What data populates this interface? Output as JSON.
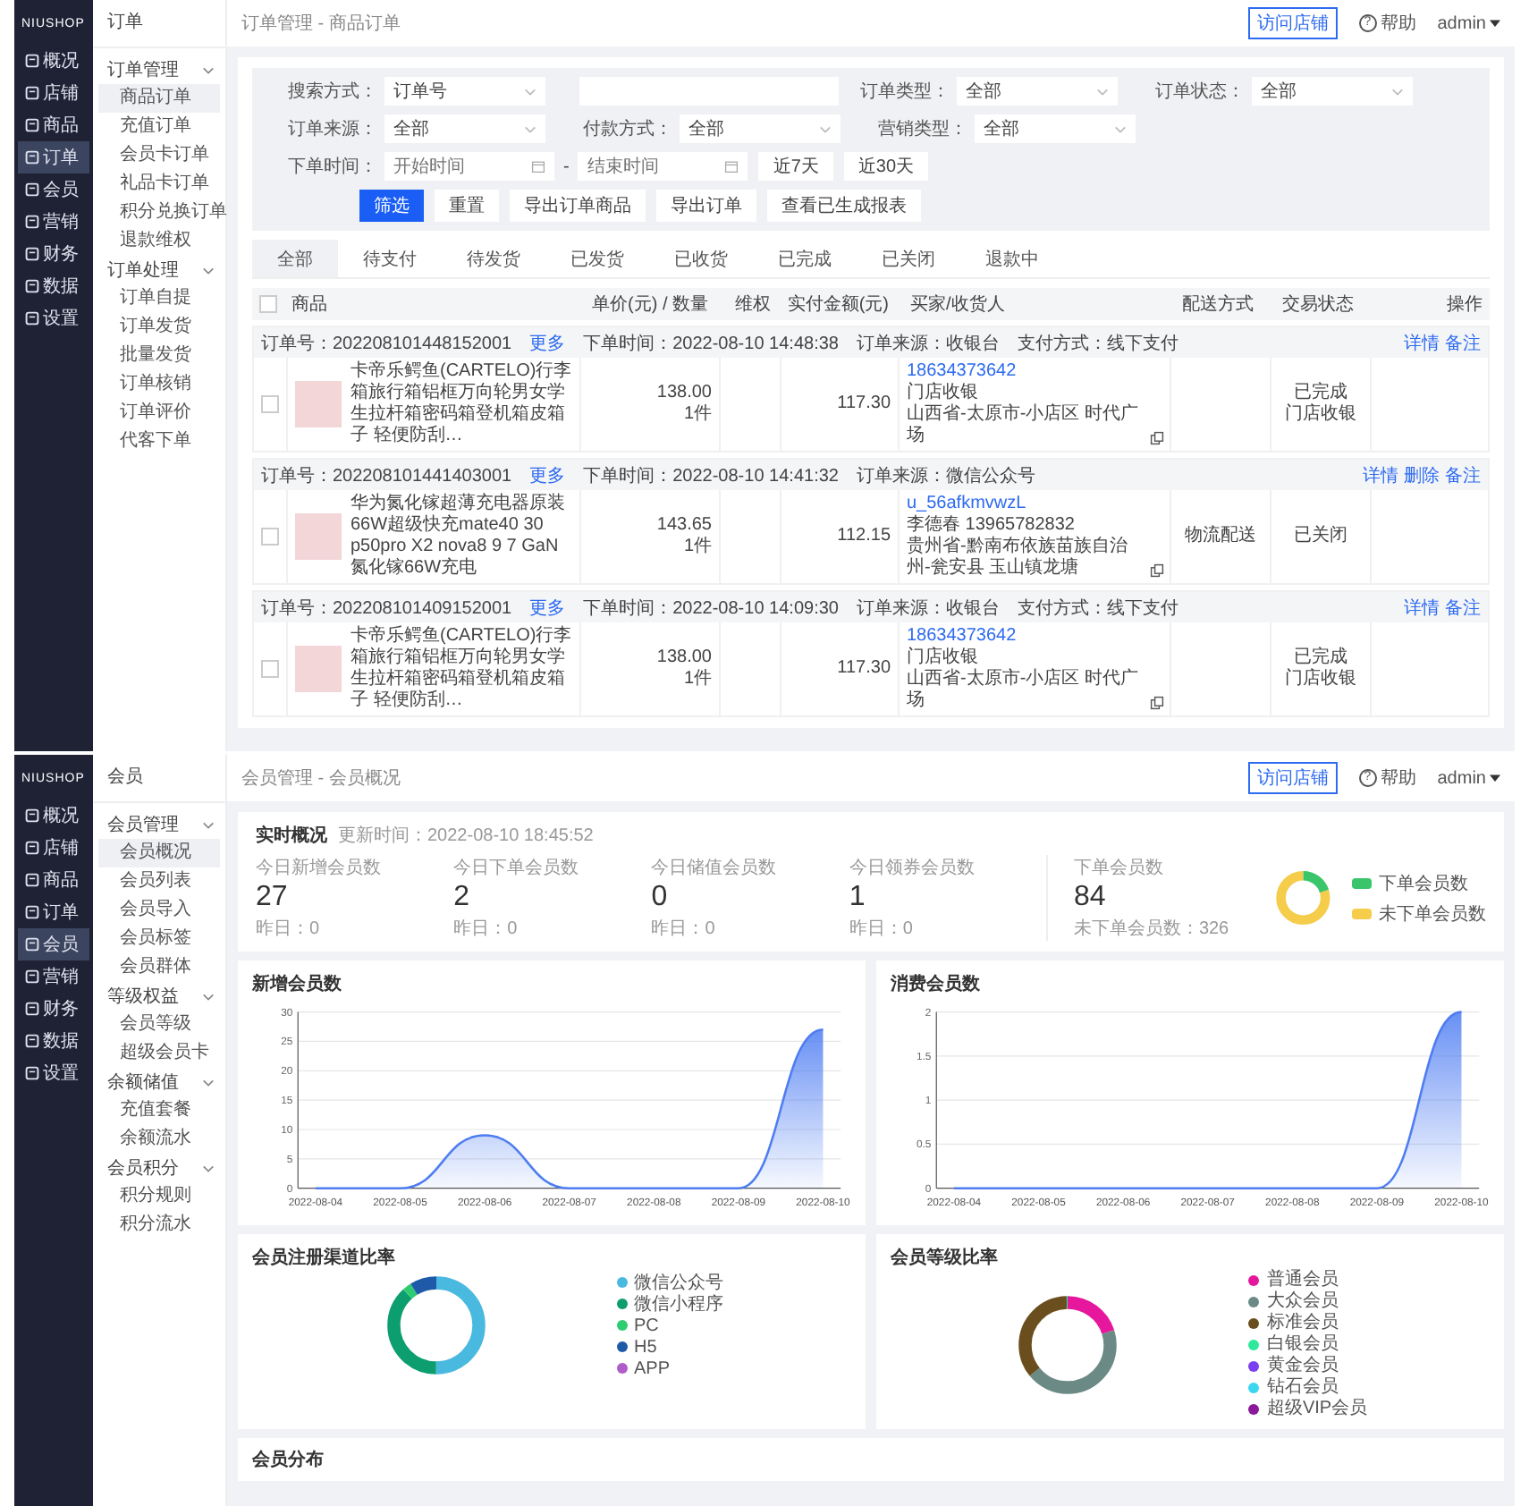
{
  "order_screen": {
    "logo": "NIUSHOP",
    "nav": [
      {
        "label": "概况",
        "selected": false
      },
      {
        "label": "店铺",
        "selected": false
      },
      {
        "label": "商品",
        "selected": false
      },
      {
        "label": "订单",
        "selected": true
      },
      {
        "label": "会员",
        "selected": false
      },
      {
        "label": "营销",
        "selected": false
      },
      {
        "label": "财务",
        "selected": false
      },
      {
        "label": "数据",
        "selected": false
      },
      {
        "label": "设置",
        "selected": false
      }
    ],
    "subnav_title": "订单",
    "subnav_groups": [
      {
        "label": "订单管理",
        "expanded": true,
        "children": [
          {
            "label": "商品订单",
            "selected": true
          },
          {
            "label": "充值订单",
            "selected": false
          },
          {
            "label": "会员卡订单",
            "selected": false
          },
          {
            "label": "礼品卡订单",
            "selected": false
          },
          {
            "label": "积分兑换订单",
            "selected": false
          },
          {
            "label": "退款维权",
            "selected": false
          }
        ]
      },
      {
        "label": "订单处理",
        "expanded": true,
        "children": [
          {
            "label": "订单自提",
            "selected": false
          },
          {
            "label": "订单发货",
            "selected": false
          },
          {
            "label": "批量发货",
            "selected": false
          },
          {
            "label": "订单核销",
            "selected": false
          },
          {
            "label": "订单评价",
            "selected": false
          },
          {
            "label": "代客下单",
            "selected": false
          }
        ]
      }
    ],
    "breadcrumb": "订单管理 - 商品订单",
    "header": {
      "visit_button": "访问店铺",
      "help_mark": "?",
      "help": "帮助",
      "user": "admin"
    },
    "filter_rows": [
      [
        {
          "kind": "select",
          "label": "搜索方式：",
          "value": "订单号"
        },
        {
          "kind": "input"
        },
        {
          "kind": "select",
          "label": "订单类型：",
          "value": "全部"
        },
        {
          "kind": "select",
          "label": "订单状态：",
          "value": "全部"
        }
      ],
      [
        {
          "kind": "select",
          "label": "订单来源：",
          "value": "全部"
        },
        {
          "kind": "select",
          "label": "付款方式：",
          "value": "全部"
        },
        {
          "kind": "select",
          "label": "营销类型：",
          "value": "全部"
        }
      ],
      [
        {
          "kind": "date",
          "label": "下单时间：",
          "placeholder": "开始时间"
        },
        {
          "kind": "dash",
          "text": "-"
        },
        {
          "kind": "date",
          "placeholder": "结束时间"
        },
        {
          "kind": "button",
          "text": "近7天"
        },
        {
          "kind": "button",
          "text": "近30天"
        }
      ]
    ],
    "actions": [
      {
        "kind": "primary",
        "text": "筛选"
      },
      {
        "kind": "default",
        "text": "重置"
      },
      {
        "kind": "default",
        "text": "导出订单商品"
      },
      {
        "kind": "default",
        "text": "导出订单"
      },
      {
        "kind": "default",
        "text": "查看已生成报表"
      }
    ],
    "tabs": [
      {
        "label": "全部",
        "selected": true
      },
      {
        "label": "待支付",
        "selected": false
      },
      {
        "label": "待发货",
        "selected": false
      },
      {
        "label": "已发货",
        "selected": false
      },
      {
        "label": "已收货",
        "selected": false
      },
      {
        "label": "已完成",
        "selected": false
      },
      {
        "label": "已关闭",
        "selected": false
      },
      {
        "label": "退款中",
        "selected": false
      }
    ],
    "select_all_checked": false,
    "columns": [
      "商品",
      "单价(元) / 数量",
      "维权",
      "实付金额(元)",
      "买家/收货人",
      "配送方式",
      "交易状态",
      "操作"
    ],
    "orders": [
      {
        "order_no": "订单号：202208101448152001",
        "more": "更多",
        "meta": [
          "下单时间：2022-08-10 14:48:38",
          "订单来源：收银台",
          "支付方式：线下支付"
        ],
        "actions": [
          "详情",
          "备注"
        ],
        "checked": false,
        "product": "卡帝乐鳄鱼(CARTELO)行李箱旅行箱铝框万向轮男女学生拉杆箱密码箱登机箱皮箱子 轻便防刮…",
        "price": "138.00",
        "quantity": "1件",
        "paid": "117.30",
        "buyer": "18634373642",
        "buyer_lines": [
          "门店收银",
          "山西省-太原市-小店区 时代广场"
        ],
        "status": [
          "已完成",
          "门店收银"
        ]
      },
      {
        "order_no": "订单号：202208101441403001",
        "more": "更多",
        "meta": [
          "下单时间：2022-08-10 14:41:32",
          "订单来源：微信公众号"
        ],
        "actions": [
          "详情",
          "删除",
          "备注"
        ],
        "checked": false,
        "product": "华为氮化镓超薄充电器原装66W超级快充mate40 30 p50pro X2 nova8 9 7 GaN氮化镓66W充电",
        "price": "143.65",
        "quantity": "1件",
        "paid": "112.15",
        "buyer": "u_56afkmvwzL",
        "buyer_lines": [
          "李德春 13965782832",
          "贵州省-黔南布依族苗族自治州-瓮安县 玉山镇龙塘"
        ],
        "delivery": "物流配送",
        "status": [
          "已关闭"
        ]
      },
      {
        "order_no": "订单号：202208101409152001",
        "more": "更多",
        "meta": [
          "下单时间：2022-08-10 14:09:30",
          "订单来源：收银台",
          "支付方式：线下支付"
        ],
        "actions": [
          "详情",
          "备注"
        ],
        "checked": false,
        "product": "卡帝乐鳄鱼(CARTELO)行李箱旅行箱铝框万向轮男女学生拉杆箱密码箱登机箱皮箱子 轻便防刮…",
        "price": "138.00",
        "quantity": "1件",
        "paid": "117.30",
        "buyer": "18634373642",
        "buyer_lines": [
          "门店收银",
          "山西省-太原市-小店区 时代广场"
        ],
        "status": [
          "已完成",
          "门店收银"
        ]
      }
    ]
  },
  "member_screen": {
    "logo": "NIUSHOP",
    "nav": [
      {
        "label": "概况",
        "selected": false
      },
      {
        "label": "店铺",
        "selected": false
      },
      {
        "label": "商品",
        "selected": false
      },
      {
        "label": "订单",
        "selected": false
      },
      {
        "label": "会员",
        "selected": true
      },
      {
        "label": "营销",
        "selected": false
      },
      {
        "label": "财务",
        "selected": false
      },
      {
        "label": "数据",
        "selected": false
      },
      {
        "label": "设置",
        "selected": false
      }
    ],
    "subnav_title": "会员",
    "subnav_groups": [
      {
        "label": "会员管理",
        "expanded": true,
        "children": [
          {
            "label": "会员概况",
            "selected": true
          },
          {
            "label": "会员列表",
            "selected": false
          },
          {
            "label": "会员导入",
            "selected": false
          },
          {
            "label": "会员标签",
            "selected": false
          },
          {
            "label": "会员群体",
            "selected": false
          }
        ]
      },
      {
        "label": "等级权益",
        "expanded": true,
        "children": [
          {
            "label": "会员等级",
            "selected": false
          },
          {
            "label": "超级会员卡",
            "selected": false
          }
        ]
      },
      {
        "label": "余额储值",
        "expanded": true,
        "children": [
          {
            "label": "充值套餐",
            "selected": false
          },
          {
            "label": "余额流水",
            "selected": false
          }
        ]
      },
      {
        "label": "会员积分",
        "expanded": true,
        "children": [
          {
            "label": "积分规则",
            "selected": false
          },
          {
            "label": "积分流水",
            "selected": false
          }
        ]
      }
    ],
    "breadcrumb": "会员管理 - 会员概况",
    "header": {
      "visit_button": "访问店铺",
      "help_mark": "?",
      "help": "帮助",
      "user": "admin"
    },
    "realtime": {
      "title": "实时概况",
      "updated": "更新时间：2022-08-10 18:45:52",
      "stats": [
        {
          "label": "今日新增会员数",
          "value": "27",
          "sub": "昨日：0"
        },
        {
          "label": "今日下单会员数",
          "value": "2",
          "sub": "昨日：0"
        },
        {
          "label": "今日储值会员数",
          "value": "0",
          "sub": "昨日：0"
        },
        {
          "label": "今日领券会员数",
          "value": "1",
          "sub": "昨日：0"
        },
        {
          "label": "下单会员数",
          "value": "84",
          "sub": "未下单会员数：326"
        }
      ],
      "legend": [
        {
          "label": "下单会员数",
          "color": "#3ac56b"
        },
        {
          "label": "未下单会员数",
          "color": "#f5cd4b"
        }
      ]
    },
    "line_charts": [
      {
        "title": "新增会员数",
        "chart_data": {
          "type": "area",
          "categories": [
            "2022-08-04",
            "2022-08-05",
            "2022-08-06",
            "2022-08-07",
            "2022-08-08",
            "2022-08-09",
            "2022-08-10"
          ],
          "values": [
            0,
            0,
            9,
            0,
            0,
            0,
            27
          ],
          "ylim": [
            0,
            30
          ],
          "yticks": [
            0,
            5,
            10,
            15,
            20,
            25,
            30
          ],
          "grid": true
        }
      },
      {
        "title": "消费会员数",
        "chart_data": {
          "type": "area",
          "categories": [
            "2022-08-04",
            "2022-08-05",
            "2022-08-06",
            "2022-08-07",
            "2022-08-08",
            "2022-08-09",
            "2022-08-10"
          ],
          "values": [
            0,
            0,
            0,
            0,
            0,
            0,
            2
          ],
          "ylim": [
            0,
            2
          ],
          "yticks": [
            0,
            0.5,
            1,
            1.5,
            2
          ],
          "grid": true
        }
      }
    ],
    "ratio_cards": [
      {
        "title": "会员注册渠道比率",
        "legend": [
          {
            "label": "微信公众号",
            "color": "#4ab9e0"
          },
          {
            "label": "微信小程序",
            "color": "#0c9e6e"
          },
          {
            "label": "PC",
            "color": "#2ecc71"
          },
          {
            "label": "H5",
            "color": "#1e5aa8"
          },
          {
            "label": "APP",
            "color": "#b05cc8"
          }
        ]
      },
      {
        "title": "会员等级比率",
        "legend": [
          {
            "label": "普通会员",
            "color": "#e6169d"
          },
          {
            "label": "大众会员",
            "color": "#6b8a85"
          },
          {
            "label": "标准会员",
            "color": "#6b4e1e"
          },
          {
            "label": "白银会员",
            "color": "#2ee89c"
          },
          {
            "label": "黄金会员",
            "color": "#7b3ff2"
          },
          {
            "label": "钻石会员",
            "color": "#3cd6f0"
          },
          {
            "label": "超级VIP会员",
            "color": "#8a1a9a"
          }
        ]
      }
    ],
    "distribution": {
      "title": "会员分布"
    }
  }
}
